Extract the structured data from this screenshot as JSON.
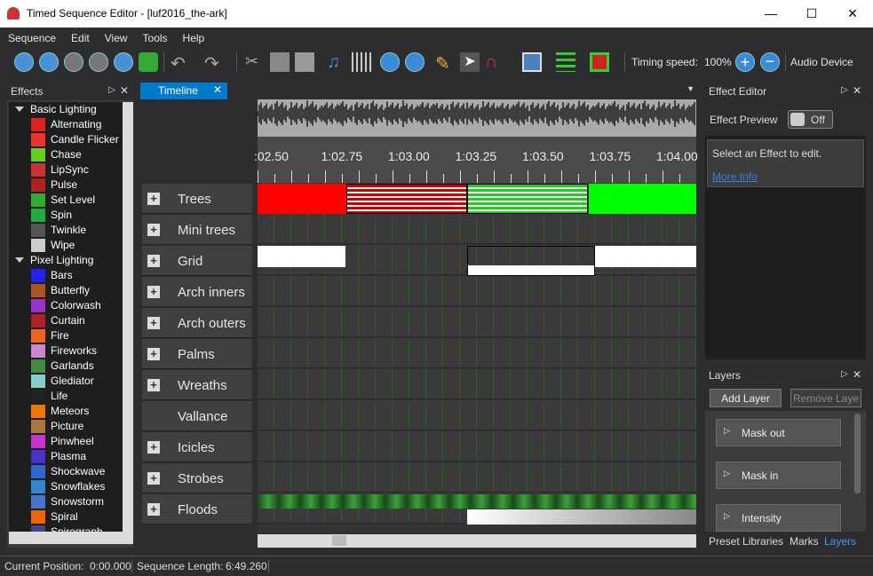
{
  "window": {
    "title": "Timed Sequence Editor - [luf2016_the-ark]"
  },
  "menu": [
    "Sequence",
    "Edit",
    "View",
    "Tools",
    "Help"
  ],
  "toolbar": {
    "timing_label": "Timing speed:",
    "timing_value": "100%",
    "audio_label": "Audio Device"
  },
  "effects_panel": {
    "title": "Effects",
    "groups": [
      {
        "label": "Basic Lighting",
        "items": [
          "Alternating",
          "Candle Flicker",
          "Chase",
          "LipSync",
          "Pulse",
          "Set Level",
          "Spin",
          "Twinkle",
          "Wipe"
        ]
      },
      {
        "label": "Pixel Lighting",
        "items": [
          "Bars",
          "Butterfly",
          "Colorwash",
          "Curtain",
          "Fire",
          "Fireworks",
          "Garlands",
          "Glediator",
          "Life",
          "Meteors",
          "Picture",
          "Pinwheel",
          "Plasma",
          "Shockwave",
          "Snowflakes",
          "Snowstorm",
          "Spiral",
          "Spirograph"
        ]
      }
    ]
  },
  "timeline": {
    "tab": "Timeline",
    "ticks": [
      ":02.50",
      "1:02.75",
      "1:03.00",
      "1:03.25",
      "1:03.50",
      "1:03.75",
      "1:04.00"
    ],
    "rows": [
      "Trees",
      "Mini trees",
      "Grid",
      "Arch inners",
      "Arch outers",
      "Palms",
      "Wreaths",
      "Vallance",
      "Icicles",
      "Strobes",
      "Floods"
    ]
  },
  "effect_editor": {
    "title": "Effect Editor",
    "preview_label": "Effect Preview",
    "toggle": "Off",
    "message": "Select an Effect to edit.",
    "link": "More Info"
  },
  "layers_panel": {
    "title": "Layers",
    "add": "Add Layer",
    "remove": "Remove Laye",
    "items": [
      "Mask out",
      "Mask in",
      "Intensity"
    ],
    "tabs": [
      "Preset Libraries",
      "Marks",
      "Layers"
    ]
  },
  "status": {
    "position_label": "Current Position:",
    "position_value": "0:00.000",
    "length_label": "Sequence Length:",
    "length_value": "6:49.260"
  }
}
